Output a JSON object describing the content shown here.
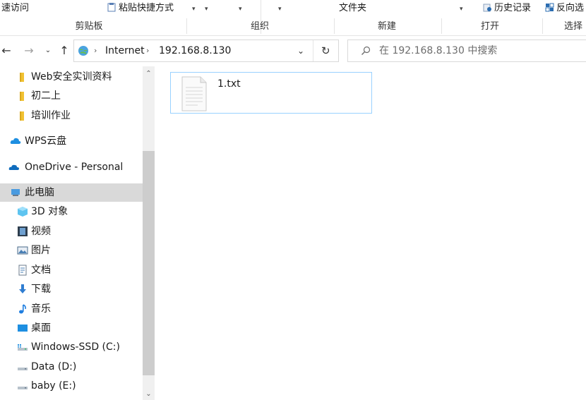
{
  "ribbon": {
    "top_left_label": "速访问",
    "paste_shortcut_label": "粘贴快捷方式",
    "new_folder_label": "文件夹",
    "history_label": "历史记录",
    "reverse_select_label": "反向选",
    "groups": {
      "clipboard": "剪贴板",
      "organize": "组织",
      "new": "新建",
      "open": "打开",
      "select": "选择"
    }
  },
  "address_bar": {
    "segments": [
      "Internet",
      "192.168.8.130"
    ],
    "search_placeholder": "在 192.168.8.130 中搜索"
  },
  "nav_pane": {
    "items": [
      {
        "label": "Web安全实训资料",
        "icon": "folder-icon"
      },
      {
        "label": "初二上",
        "icon": "folder-icon"
      },
      {
        "label": "培训作业",
        "icon": "folder-icon"
      },
      {
        "label": "WPS云盘",
        "icon": "cloud-icon"
      },
      {
        "label": "OneDrive - Personal",
        "icon": "onedrive-icon"
      },
      {
        "label": "此电脑",
        "icon": "computer-icon",
        "selected": true
      },
      {
        "label": "3D 对象",
        "icon": "cube-icon"
      },
      {
        "label": "视频",
        "icon": "film-icon"
      },
      {
        "label": "图片",
        "icon": "picture-icon"
      },
      {
        "label": "文档",
        "icon": "document-icon"
      },
      {
        "label": "下载",
        "icon": "download-icon"
      },
      {
        "label": "音乐",
        "icon": "music-icon"
      },
      {
        "label": "桌面",
        "icon": "desktop-icon"
      },
      {
        "label": "Windows-SSD (C:)",
        "icon": "windows-drive-icon"
      },
      {
        "label": "Data (D:)",
        "icon": "drive-icon"
      },
      {
        "label": "baby (E:)",
        "icon": "drive-icon"
      }
    ]
  },
  "content": {
    "files": [
      {
        "name": "1.txt",
        "icon": "text-file-icon"
      }
    ]
  },
  "colors": {
    "selection_border": "#99d1ff",
    "selected_nav_bg": "#d9d9d9",
    "folder": "#f1c232",
    "onedrive": "#0f6cbd"
  }
}
